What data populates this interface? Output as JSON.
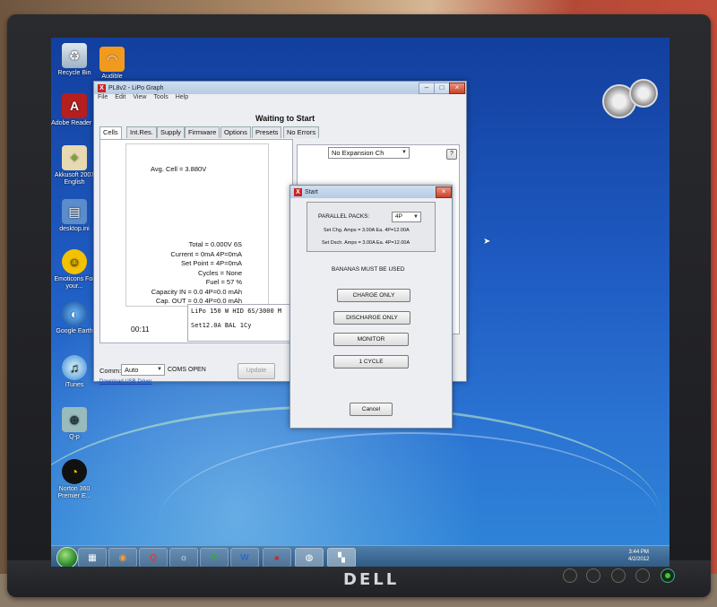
{
  "desktop_icons": [
    {
      "label": "Recycle Bin",
      "icon": "recycle-bin-icon"
    },
    {
      "label": "Audible",
      "icon": "audible-icon"
    },
    {
      "label": "Adobe Reader X",
      "icon": "adobe-reader-icon"
    },
    {
      "label": "Akkusoft 2007 English",
      "icon": "akkusoft-icon"
    },
    {
      "label": "desktop.ini",
      "icon": "file-icon"
    },
    {
      "label": "Emoticons For your...",
      "icon": "emoticon-icon"
    },
    {
      "label": "Google Earth",
      "icon": "google-earth-icon"
    },
    {
      "label": "iTunes",
      "icon": "itunes-icon"
    },
    {
      "label": "Q-p",
      "icon": "app-icon"
    },
    {
      "label": "Norton 360 Premier E...",
      "icon": "norton-icon"
    }
  ],
  "main_window": {
    "title": "PL8v2 - LiPo Graph",
    "menu": [
      "File",
      "Edit",
      "View",
      "Tools",
      "Help"
    ],
    "status_title": "Waiting to Start",
    "tabs": [
      "Cells",
      "Int.Res.",
      "Supply",
      "Firmware",
      "Options",
      "Presets",
      "No Errors"
    ],
    "avg_cell": "Avg. Cell = 3.880V",
    "stats": [
      "Total = 0.000V  6S",
      "Current = 0mA  4P=0mA",
      "Set Point = 4P=0mA",
      "Cycles = None",
      "Fuel = 57 %",
      "Capacity IN = 0.0  4P=0.0 mAh",
      "Cap. OUT = 0.0  4P=0.0 mAh"
    ],
    "timer": "00:11",
    "preset_line1": "LiPo 150 W HID 6S/3000 M",
    "preset_line2": "Set12.0A BAL 1Cy",
    "expansion_select": "No Expansion Ch",
    "help_button": "?",
    "comm_label": "Comm:",
    "comm_value": "Auto",
    "coms_status": "COMS OPEN",
    "update_button": "Update",
    "download_link": "Download USB Driver"
  },
  "start_dialog": {
    "title": "Start",
    "parallel_label": "PARALLEL PACKS:",
    "parallel_value": "4P",
    "chg_amps": "Set Chg. Amps =  3.00A Ea.  4P=12.00A",
    "dsch_amps": "Set Dsch. Amps =  3.00A Ea.  4P=12.00A",
    "warning": "BANANAS MUST BE USED",
    "buttons": [
      "CHARGE ONLY",
      "DISCHARGE ONLY",
      "MONITOR",
      "1 CYCLE"
    ],
    "cancel": "Cancel"
  },
  "taskbar": {
    "apps": [
      "Explorer",
      "Firefox",
      "Q",
      "App",
      "Excel",
      "Word",
      "FMA",
      "PL8",
      "Start"
    ],
    "time": "3:44 PM",
    "date": "4/2/2012"
  },
  "monitor_brand": "DELL",
  "colors": {
    "accent": "#c22222",
    "desktop": "#1f5cc3",
    "taskbar": "#3f6d98"
  }
}
